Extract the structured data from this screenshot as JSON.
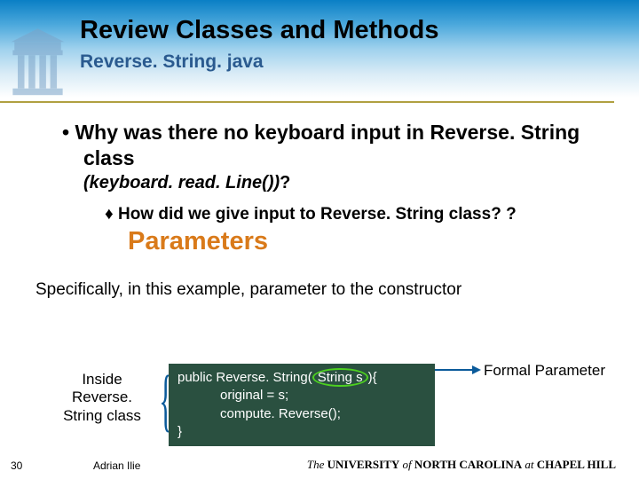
{
  "header": {
    "title": "Review Classes and Methods",
    "subtitle": "Reverse. String. java"
  },
  "main_bullet": "Why was there no keyboard input in Reverse. String class",
  "sub_italic_prefix": "(keyboard. read. Line())",
  "sub_italic_suffix": "?",
  "sub_bullet_prefix": "How did we give input to Reverse. String class? ?",
  "params_word": "Parameters",
  "specifically": "Specifically, in this example, parameter to the constructor",
  "inside_label": "Inside Reverse. String class",
  "code": {
    "line1a": "public Reverse. String(",
    "line1_hl": "String s",
    "line1b": "){",
    "line2": "original = s;",
    "line3": "compute. Reverse();",
    "line4": "}"
  },
  "formal_label": "Formal Parameter",
  "footer": {
    "slide_num": "30",
    "author": "Adrian Ilie",
    "univ_the": "The ",
    "univ_u": "UNIVERSITY",
    "univ_of": " of ",
    "univ_nc": "NORTH  CAROLINA",
    "univ_at": " at ",
    "univ_ch": "CHAPEL HILL"
  }
}
